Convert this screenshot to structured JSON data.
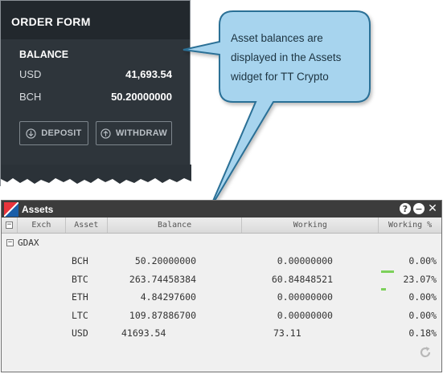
{
  "order_form": {
    "title": "ORDER FORM",
    "balance_title": "BALANCE",
    "balances": [
      {
        "label": "USD",
        "value": "41,693.54"
      },
      {
        "label": "BCH",
        "value": "50.20000000"
      }
    ],
    "deposit_label": "DEPOSIT",
    "withdraw_label": "WITHDRAW"
  },
  "callout": {
    "text": "Asset balances are displayed in the Assets widget for TT Crypto"
  },
  "assets_widget": {
    "title": "Assets",
    "controls": [
      "help-icon",
      "minimize-icon",
      "close-icon"
    ],
    "columns": [
      "Exch",
      "Asset",
      "Balance",
      "Working",
      "Working %"
    ],
    "group": {
      "name": "GDAX",
      "expanded": true
    },
    "rows": [
      {
        "asset": "BCH",
        "balance": "50.20000000",
        "working": "0.00000000",
        "working_pct": "0.00%",
        "pct_fill": 0
      },
      {
        "asset": "BTC",
        "balance": "263.74458384",
        "working": "60.84848521",
        "working_pct": "23.07%",
        "pct_fill": 0.2307
      },
      {
        "asset": "ETH",
        "balance": "4.84297600",
        "working": "0.00000000",
        "working_pct": "0.00%",
        "pct_fill": 0.09
      },
      {
        "asset": "LTC",
        "balance": "109.87886700",
        "working": "0.00000000",
        "working_pct": "0.00%",
        "pct_fill": 0
      },
      {
        "asset": "USD",
        "balance": "41693.54",
        "working": "73.11",
        "working_pct": "0.18%",
        "pct_fill": 0
      }
    ]
  },
  "colors": {
    "panel_bg": "#2b3238",
    "callout_fill": "#a7d4ee",
    "callout_border": "#2b6f96",
    "bar_green": "#7cd05a",
    "title_bar": "#3c3c3c"
  }
}
